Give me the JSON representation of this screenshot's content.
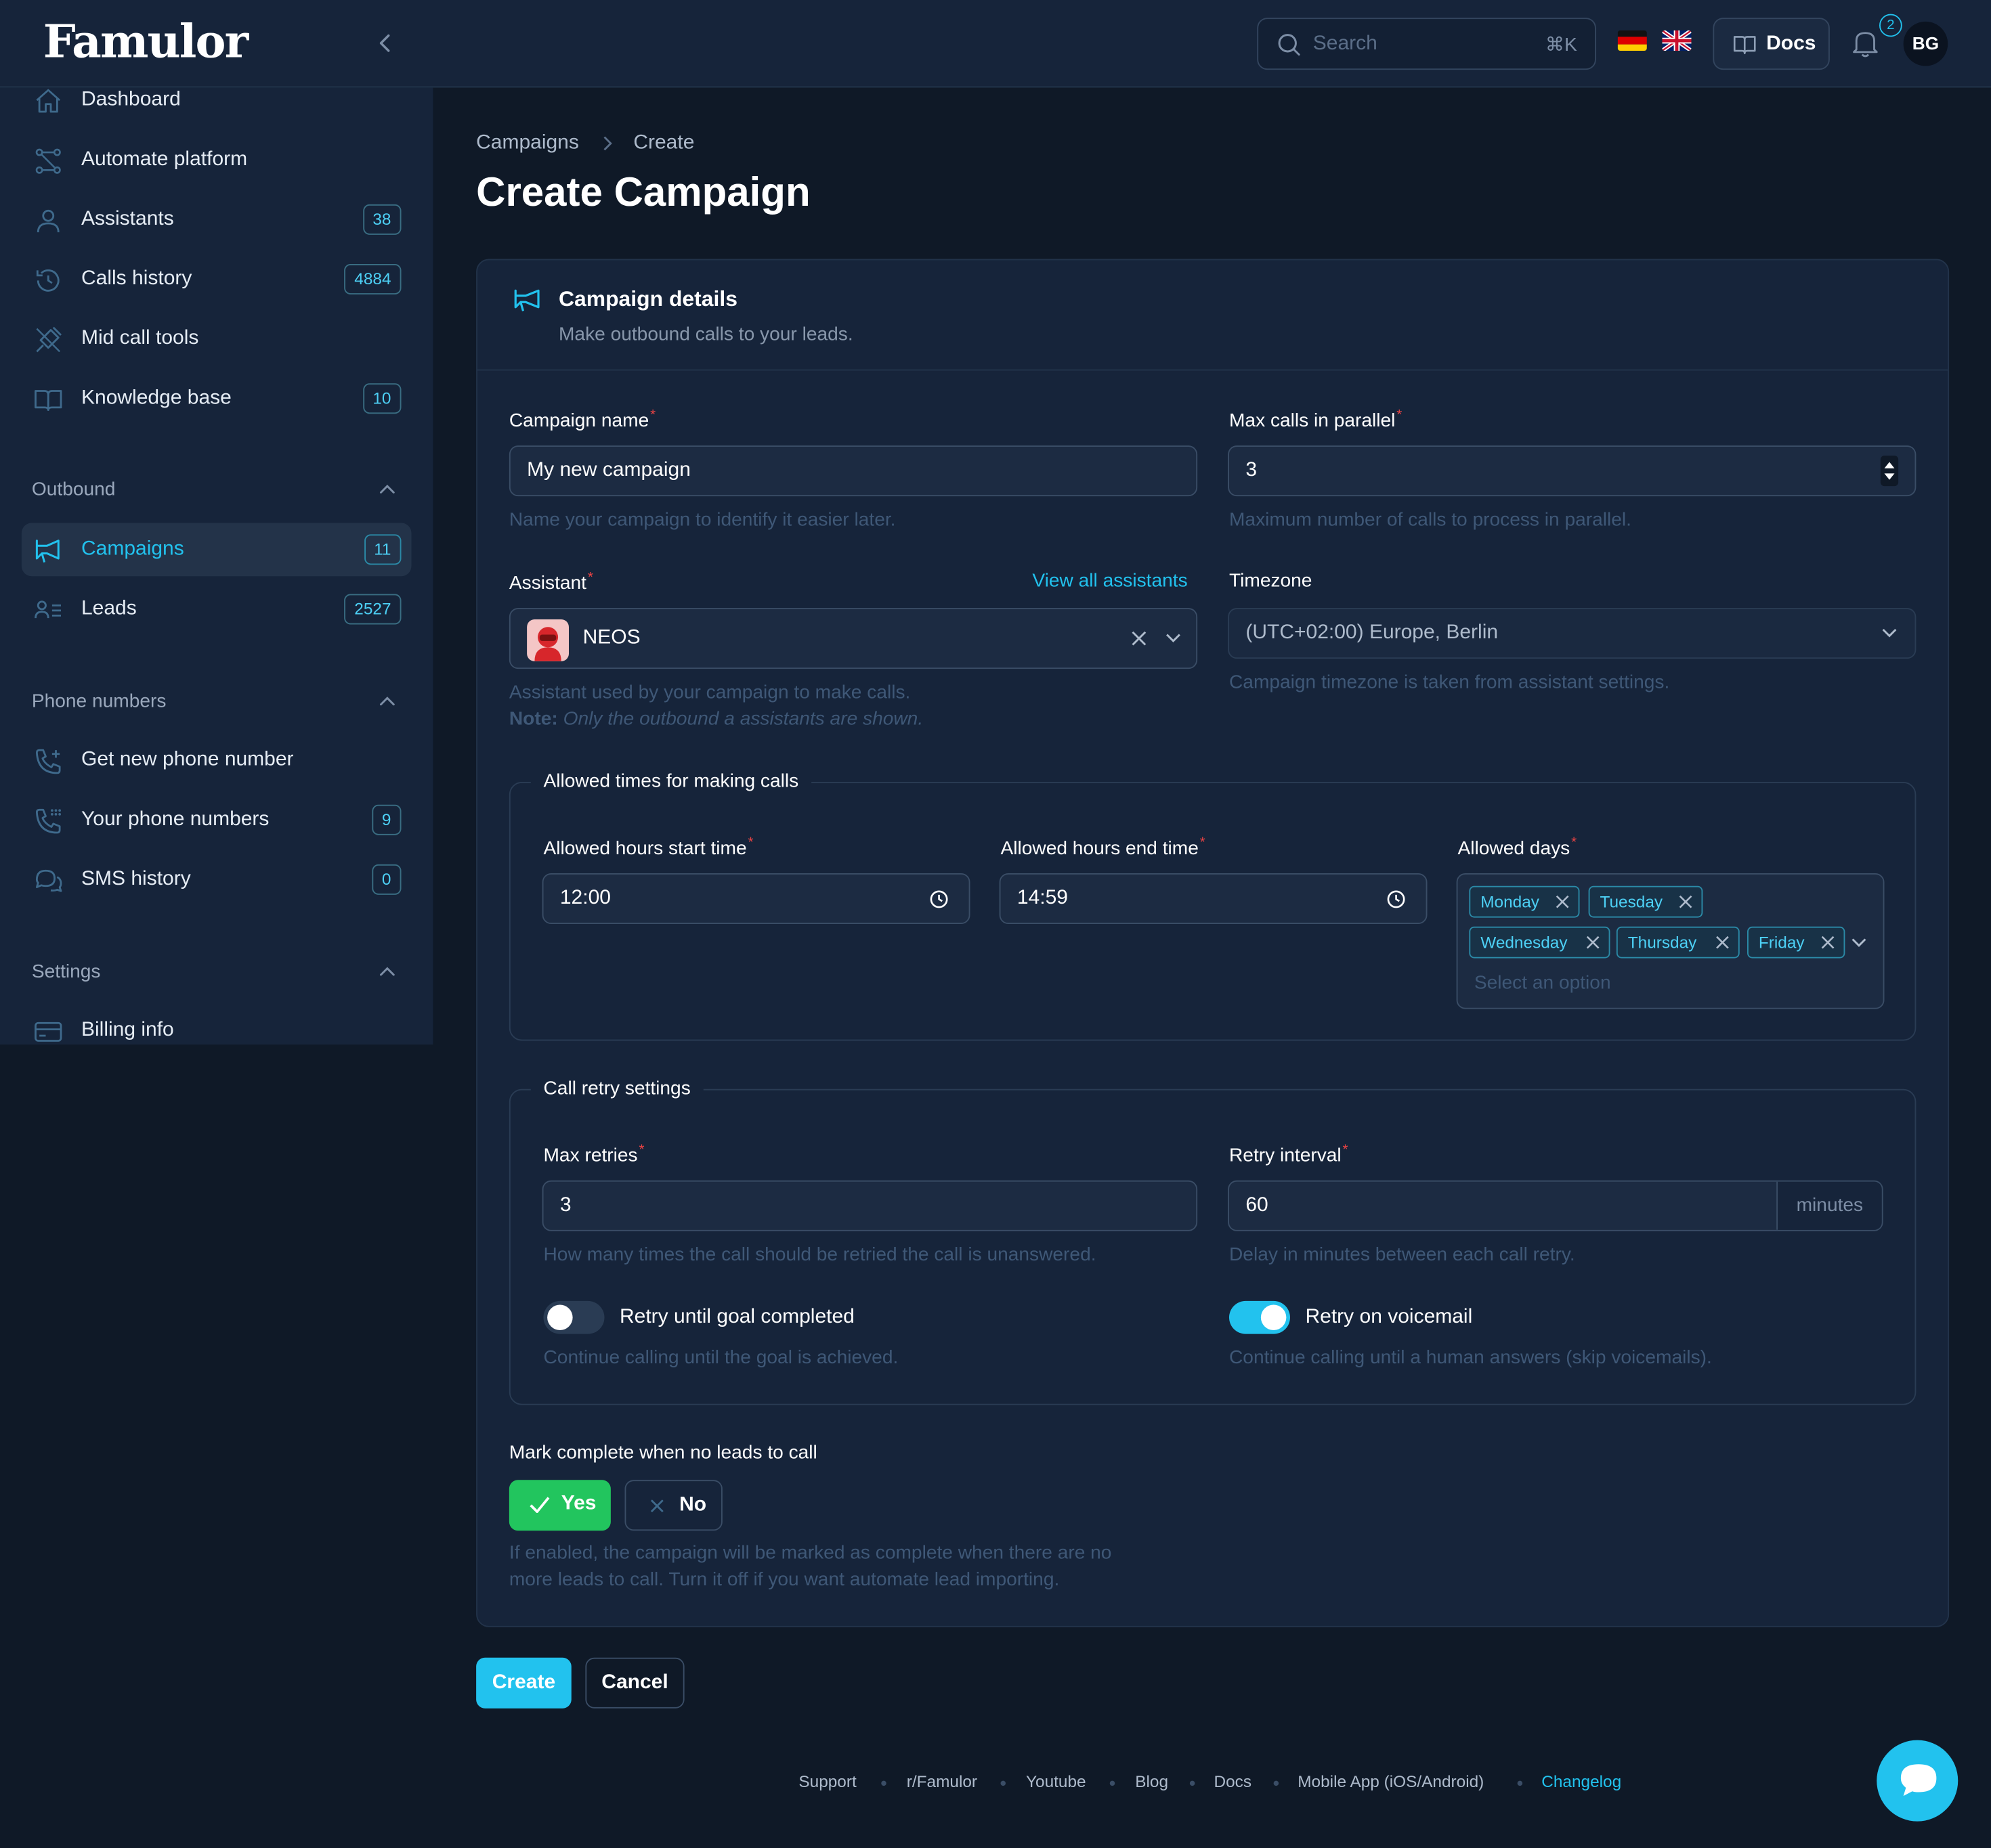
{
  "app": {
    "logo": "Famulor"
  },
  "topbar": {
    "search_placeholder": "Search",
    "search_shortcut": "⌘K",
    "docs_label": "Docs",
    "notification_count": "2",
    "avatar_initials": "BG"
  },
  "sidebar": {
    "items": [
      {
        "label": "Dashboard",
        "icon": "home-icon"
      },
      {
        "label": "Automate platform",
        "icon": "flow-icon"
      },
      {
        "label": "Assistants",
        "icon": "user-icon",
        "badge": "38"
      },
      {
        "label": "Calls history",
        "icon": "history-icon",
        "badge": "4884"
      },
      {
        "label": "Mid call tools",
        "icon": "tools-icon"
      },
      {
        "label": "Knowledge base",
        "icon": "book-icon",
        "badge": "10"
      }
    ],
    "outbound": {
      "title": "Outbound",
      "items": [
        {
          "label": "Campaigns",
          "icon": "megaphone-icon",
          "badge": "11",
          "active": true
        },
        {
          "label": "Leads",
          "icon": "leads-icon",
          "badge": "2527"
        }
      ]
    },
    "phone_numbers": {
      "title": "Phone numbers",
      "items": [
        {
          "label": "Get new phone number",
          "icon": "phone-plus-icon"
        },
        {
          "label": "Your phone numbers",
          "icon": "phone-grid-icon",
          "badge": "9"
        },
        {
          "label": "SMS history",
          "icon": "chat-icon",
          "badge": "0"
        }
      ]
    },
    "settings": {
      "title": "Settings",
      "items": [
        {
          "label": "Billing info",
          "icon": "card-icon"
        }
      ]
    }
  },
  "breadcrumb": {
    "parent": "Campaigns",
    "current": "Create"
  },
  "page": {
    "title": "Create Campaign"
  },
  "card": {
    "title": "Campaign details",
    "subtitle": "Make outbound calls to your leads."
  },
  "form": {
    "campaign_name": {
      "label": "Campaign name",
      "value": "My new campaign",
      "hint": "Name your campaign to identify it easier later."
    },
    "max_calls": {
      "label": "Max calls in parallel",
      "value": "3",
      "hint": "Maximum number of calls to process in parallel."
    },
    "assistant": {
      "label": "Assistant",
      "link": "View all assistants",
      "value": "NEOS",
      "hint": "Assistant used by your campaign to make calls.",
      "note_label": "Note:",
      "note_text": "Only the outbound a assistants are shown."
    },
    "timezone": {
      "label": "Timezone",
      "value": "(UTC+02:00) Europe, Berlin",
      "hint": "Campaign timezone is taken from assistant settings."
    },
    "allowed_times": {
      "legend": "Allowed times for making calls",
      "start_label": "Allowed hours start time",
      "start_value": "12:00",
      "end_label": "Allowed hours end time",
      "end_value": "14:59",
      "days_label": "Allowed days",
      "days": [
        "Monday",
        "Tuesday",
        "Wednesday",
        "Thursday",
        "Friday"
      ],
      "days_placeholder": "Select an option"
    },
    "retry": {
      "legend": "Call retry settings",
      "max_retries_label": "Max retries",
      "max_retries_value": "3",
      "max_retries_hint": "How many times the call should be retried the call is unanswered.",
      "interval_label": "Retry interval",
      "interval_value": "60",
      "interval_suffix": "minutes",
      "interval_hint": "Delay in minutes between each call retry.",
      "goal_label": "Retry until goal completed",
      "goal_hint": "Continue calling until the goal is achieved.",
      "goal_enabled": false,
      "voicemail_label": "Retry on voicemail",
      "voicemail_hint": "Continue calling until a human answers (skip voicemails).",
      "voicemail_enabled": true
    },
    "mark_complete": {
      "label": "Mark complete when no leads to call",
      "yes": "Yes",
      "no": "No",
      "hint_line1": "If enabled, the campaign will be marked as complete when there are no",
      "hint_line2": "more leads to call. Turn it off if you want automate lead importing."
    }
  },
  "actions": {
    "create": "Create",
    "cancel": "Cancel"
  },
  "footer": {
    "links": [
      "Support",
      "r/Famulor",
      "Youtube",
      "Blog",
      "Docs",
      "Mobile App (iOS/Android)",
      "Changelog"
    ]
  },
  "colors": {
    "accent": "#22c2ee",
    "success": "#22c55e",
    "required": "#ef4444",
    "background": "#0f1927",
    "surface": "#16243a"
  }
}
